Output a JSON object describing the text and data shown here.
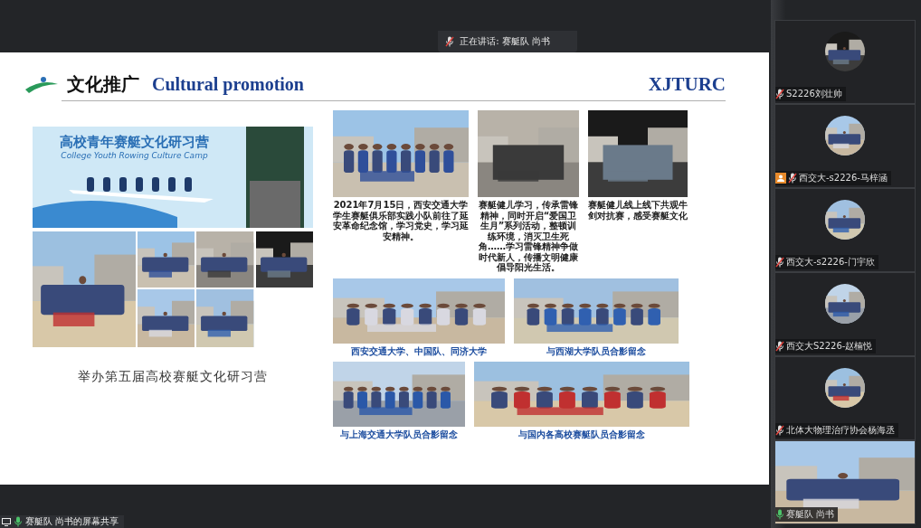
{
  "speaking_banner": {
    "text": "正在讲话: 赛艇队 尚书"
  },
  "slide": {
    "title_cn": "文化推广",
    "title_en": "Cultural promotion",
    "brand": "XJTURC",
    "camp_banner": {
      "title": "高校青年赛艇文化研习营",
      "subtitle": "College Youth Rowing Culture Camp"
    },
    "left_caption": "举办第五届高校赛艇文化研习营",
    "photos": [
      {
        "kind": "picture",
        "caption": "2021年7月15日，西安交通大学学生赛艇俱乐部实践小队前往了延安革命纪念馆，学习党史，学习延安精神。"
      },
      {
        "kind": "picture",
        "caption": "赛艇健儿学习，传承雷锋精神，同时开启“爱国卫生月”系列活动，整顿训练环境，消灭卫生死角……学习雷锋精神争做时代新人，传播文明健康倡导阳光生活。"
      },
      {
        "kind": "picture",
        "caption": "赛艇健儿线上线下共观牛剑对抗赛，感受赛艇文化"
      },
      {
        "kind": "picture",
        "caption": "西安交通大学、中国队、同济大学"
      },
      {
        "kind": "picture",
        "caption": "与西湖大学队员合影留念"
      },
      {
        "kind": "picture",
        "caption": "与上海交通大学队员合影留念"
      },
      {
        "kind": "picture",
        "caption": "与国内各高校赛艇队员合影留念"
      }
    ]
  },
  "participants": [
    {
      "name": "S2226刘壮帅",
      "muted": true,
      "host": false,
      "kind": "avatar"
    },
    {
      "name": "西交大-s2226-马梓涵",
      "muted": true,
      "host": true,
      "kind": "avatar"
    },
    {
      "name": "西交大-s2226-门宇欣",
      "muted": true,
      "host": false,
      "kind": "avatar"
    },
    {
      "name": "西交大S2226-赵楠悦",
      "muted": true,
      "host": false,
      "kind": "avatar"
    },
    {
      "name": "北体大物理治疗协会杨海丞",
      "muted": true,
      "host": false,
      "kind": "avatar"
    },
    {
      "name": "赛艇队 尚书",
      "muted": false,
      "host": false,
      "kind": "video"
    }
  ],
  "share_label": "赛艇队 尚书的屏幕共享"
}
